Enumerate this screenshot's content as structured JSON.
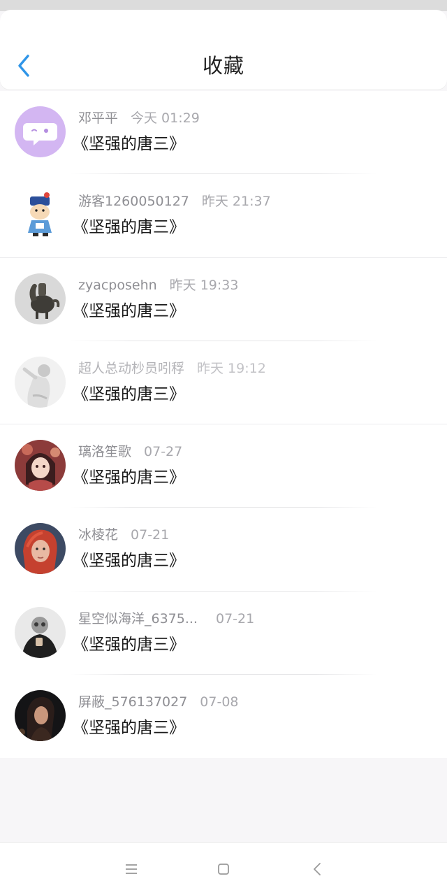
{
  "header": {
    "title": "收藏"
  },
  "favorites": [
    {
      "name": "邓平平",
      "time": "今天 01:29",
      "content": "《坚强的唐三》"
    },
    {
      "name": "游客1260050127",
      "time": "昨天 21:37",
      "content": "《坚强的唐三》"
    },
    {
      "name": "zyacposehn",
      "time": "昨天 19:33",
      "content": "《坚强的唐三》"
    },
    {
      "name": "超人总动杪员吲稃",
      "time": "昨天 19:12",
      "content": "《坚强的唐三》"
    },
    {
      "name": "璃洛笙歌",
      "time": "07-27",
      "content": "《坚强的唐三》"
    },
    {
      "name": "冰棱花",
      "time": "07-21",
      "content": "《坚强的唐三》"
    },
    {
      "name": "星空似海洋_6375...",
      "time": "07-21",
      "content": "《坚强的唐三》"
    },
    {
      "name": "屏蔽_576137027",
      "time": "07-08",
      "content": "《坚强的唐三》"
    }
  ],
  "colors": {
    "accent": "#2f95e8",
    "name_text": "#8f8f94",
    "content_text": "#1b1b1b",
    "background": "#f7f6f8"
  },
  "icons": {
    "back": "chevron-left-icon",
    "nav_menu": "menu-icon",
    "nav_home": "home-square-icon",
    "nav_back": "back-triangle-icon"
  }
}
